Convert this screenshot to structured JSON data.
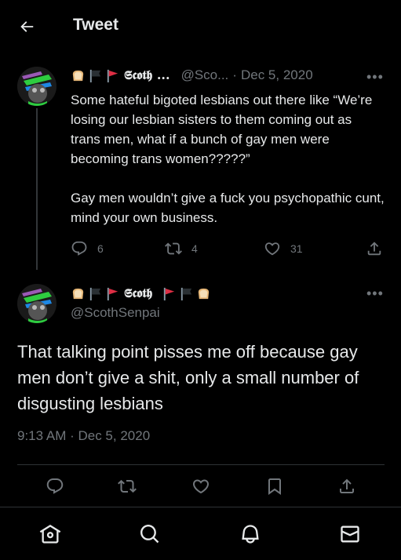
{
  "header": {
    "title": "Tweet"
  },
  "parent_tweet": {
    "display_name": "𝕾𝖈𝖔𝖙𝖍 ...",
    "handle": "@Sco...",
    "separator": "·",
    "date": "Dec 5, 2020",
    "text": "Some hateful bigoted lesbians out there like “We’re losing our lesbian sisters to them coming out as trans men, what if a bunch of gay men were becoming trans women?????”\n\nGay men wouldn’t give a fuck you psychopathic cunt, mind your own business.",
    "replies": "6",
    "retweets": "4",
    "likes": "31",
    "emojis_prefix": [
      "bread-emoji",
      "black-flag-emoji",
      "red-flag-emoji"
    ]
  },
  "main_tweet": {
    "display_name": "𝕾𝖈𝖔𝖙𝖍",
    "handle": "@ScothSenpai",
    "text": "That talking point pisses me off because gay men don’t give a shit, only a small number of disgusting lesbians",
    "timestamp": "9:13 AM · Dec 5, 2020",
    "emojis_prefix": [
      "bread-emoji",
      "black-flag-emoji",
      "red-flag-emoji"
    ],
    "emojis_suffix": [
      "red-flag-emoji",
      "black-flag-emoji",
      "bread-emoji"
    ]
  },
  "more_glyph": "•••",
  "colors": {
    "background": "#000000",
    "text": "#e7e9ea",
    "muted": "#71767b",
    "divider": "#2f3336"
  },
  "bottom_nav": [
    "home-icon",
    "search-icon",
    "notifications-icon",
    "messages-icon"
  ]
}
